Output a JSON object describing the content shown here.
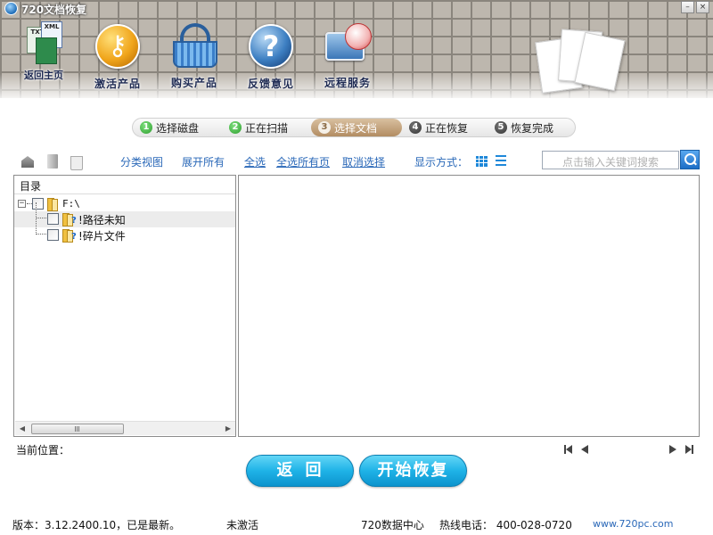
{
  "window": {
    "title": "720文档恢复",
    "min_glyph": "–",
    "close_glyph": "×"
  },
  "toolbar": {
    "home": {
      "label": "返回主页",
      "icon": "document-files-icon",
      "doc_labels": [
        "TXT",
        "XML"
      ]
    },
    "activate": {
      "label": "激活产品",
      "icon": "key-icon"
    },
    "buy": {
      "label": "购买产品",
      "icon": "shopping-basket-icon"
    },
    "feedback": {
      "label": "反馈意见",
      "icon": "help-question-icon",
      "glyph": "?"
    },
    "remote": {
      "label": "远程服务",
      "icon": "remote-monitor-icon"
    }
  },
  "steps": [
    {
      "num": "1",
      "label": "选择磁盘",
      "state": "done"
    },
    {
      "num": "2",
      "label": "正在扫描",
      "state": "done"
    },
    {
      "num": "3",
      "label": "选择文档",
      "state": "active"
    },
    {
      "num": "4",
      "label": "正在恢复",
      "state": "pending"
    },
    {
      "num": "5",
      "label": "恢复完成",
      "state": "pending"
    }
  ],
  "actions": {
    "category_view": "分类视图",
    "expand_all": "展开所有",
    "select_all": "全选",
    "select_all_pages": "全选所有页",
    "deselect": "取消选择",
    "display_mode_label": "显示方式：",
    "search_placeholder": "点击输入关键词搜索"
  },
  "tree": {
    "header": "目录",
    "root": {
      "label": "F:\\",
      "toggle": "−"
    },
    "children": [
      {
        "label": "!路径未知",
        "mark": "?",
        "selected": true
      },
      {
        "label": "!碎片文件",
        "mark": "?",
        "selected": false
      }
    ]
  },
  "current_position_label": "当前位置：",
  "buttons": {
    "back": "返回",
    "start_recovery": "开始恢复"
  },
  "status": {
    "version": "版本：3.12.2400.10，已是最新。",
    "activation": "未激活",
    "data_center": "720数据中心",
    "hotline": "热线电话： 400-028-0720",
    "website": "www.720pc.com"
  },
  "colors": {
    "accent_blue": "#1e88d9",
    "link_blue": "#2a68b8",
    "button_cyan": "#1fb3e7",
    "active_step": "#b28c62",
    "step_done_green": "#2e9e2e"
  }
}
